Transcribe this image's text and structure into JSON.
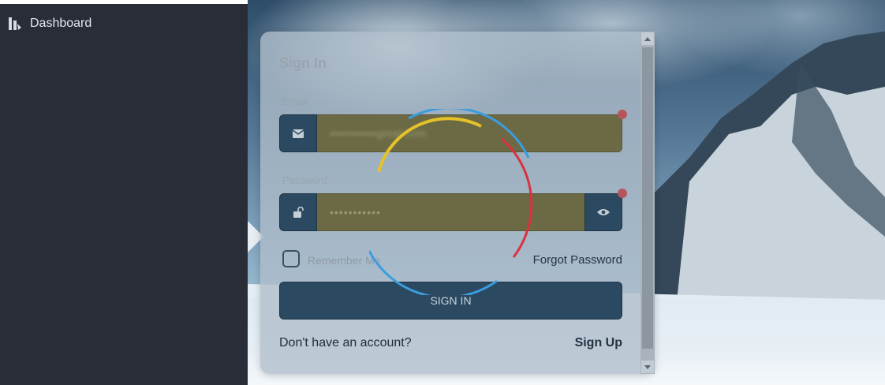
{
  "sidebar": {
    "items": [
      {
        "label": "Dashboard",
        "icon": "dashboard-icon"
      }
    ]
  },
  "signin": {
    "title": "Sign In",
    "email": {
      "label": "Email",
      "value": "••••••••••••gmail.com",
      "icon": "envelope-icon"
    },
    "password": {
      "label": "Password",
      "value": "•••••••••••",
      "icon": "unlock-icon",
      "toggle_icon": "eye-icon"
    },
    "remember_label": "Remember Me",
    "forgot_label": "Forgot Password",
    "submit_label": "SIGN IN",
    "no_account_text": "Don't have an account?",
    "signup_label": "Sign Up"
  },
  "colors": {
    "sidebar_bg": "#282d38",
    "primary": "#2b4960",
    "input_bg": "#6b6a44",
    "required_dot": "#b5565c",
    "spinner": [
      "#e5c229",
      "#3a9de0",
      "#d8333c"
    ]
  }
}
